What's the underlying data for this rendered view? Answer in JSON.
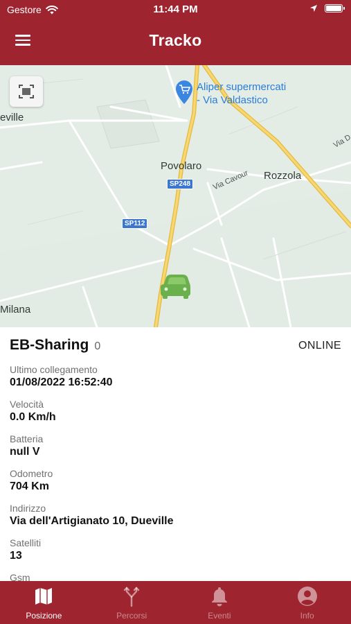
{
  "status_bar": {
    "carrier": "Gestore",
    "time": "11:44 PM"
  },
  "header": {
    "title": "Tracko"
  },
  "map": {
    "places": {
      "dueville": "eville",
      "povolaro": "Povolaro",
      "rozzola": "Rozzola",
      "milana": "Milana"
    },
    "poi": {
      "line1": "Aliper supermercati",
      "line2": "- Via Valdastico"
    },
    "road_shields": {
      "sp248": "SP248",
      "sp112": "SP112"
    },
    "road_names": {
      "via_cavour": "Via Cavour",
      "via_d": "Via D"
    },
    "colors": {
      "land": "#e4ece6",
      "major_road": "#f2c94c",
      "minor_road": "#ffffff",
      "vehicle": "#6ab04c",
      "poi": "#2a7ed8"
    }
  },
  "vehicle": {
    "name": "EB-Sharing",
    "count": "0",
    "status": "ONLINE",
    "fields": [
      {
        "label": "Ultimo collegamento",
        "value": "01/08/2022 16:52:40"
      },
      {
        "label": "Velocità",
        "value": "0.0 Km/h"
      },
      {
        "label": "Batteria",
        "value": "null V"
      },
      {
        "label": "Odometro",
        "value": "704 Km"
      },
      {
        "label": "Indirizzo",
        "value": "Via dell'Artigianato 10, Dueville"
      },
      {
        "label": "Satelliti",
        "value": "13"
      },
      {
        "label": "Gsm",
        "value": ""
      }
    ]
  },
  "tabs": [
    {
      "label": "Posizione",
      "icon": "map-icon",
      "active": true
    },
    {
      "label": "Percorsi",
      "icon": "route-icon",
      "active": false
    },
    {
      "label": "Eventi",
      "icon": "bell-icon",
      "active": false
    },
    {
      "label": "Info",
      "icon": "user-icon",
      "active": false
    }
  ],
  "theme": {
    "primary": "#9e2530"
  }
}
